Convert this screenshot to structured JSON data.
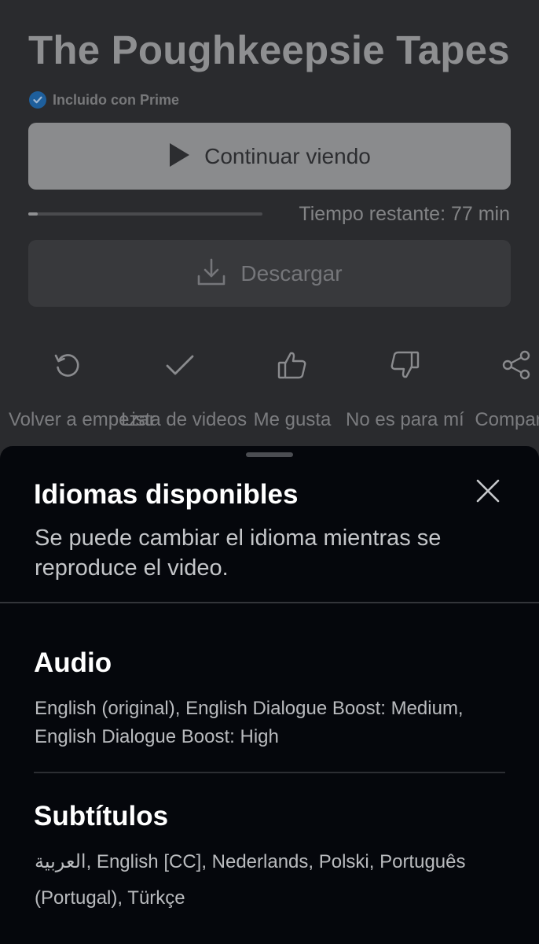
{
  "detail": {
    "title": "The Poughkeepsie Tapes",
    "prime_label": "Incluido con Prime",
    "continue_label": "Continuar viendo",
    "progress_fraction": 0.04,
    "remaining_label": "Tiempo restante: 77 min",
    "download_label": "Descargar",
    "actions": [
      {
        "label": "Volver a empezar",
        "icon": "restart-icon"
      },
      {
        "label": "Lista de videos",
        "icon": "check-icon"
      },
      {
        "label": "Me gusta",
        "icon": "thumbs-up-icon"
      },
      {
        "label": "No es para mí",
        "icon": "thumbs-down-icon"
      },
      {
        "label": "Compartir",
        "icon": "share-icon"
      }
    ]
  },
  "sheet": {
    "title": "Idiomas disponibles",
    "subtitle": "Se puede cambiar el idioma mientras se reproduce el video.",
    "audio": {
      "title": "Audio",
      "languages": "English (original), English Dialogue Boost: Medium, English Dialogue Boost: High"
    },
    "subtitles": {
      "title": "Subtítulos",
      "languages": "العربية, English [CC], Nederlands, Polski, Português (Portugal), Türkçe"
    }
  },
  "colors": {
    "sheet_bg": "#05070c",
    "detail_bg": "#2a2b2e",
    "prime_badge": "#1e5f9c"
  }
}
